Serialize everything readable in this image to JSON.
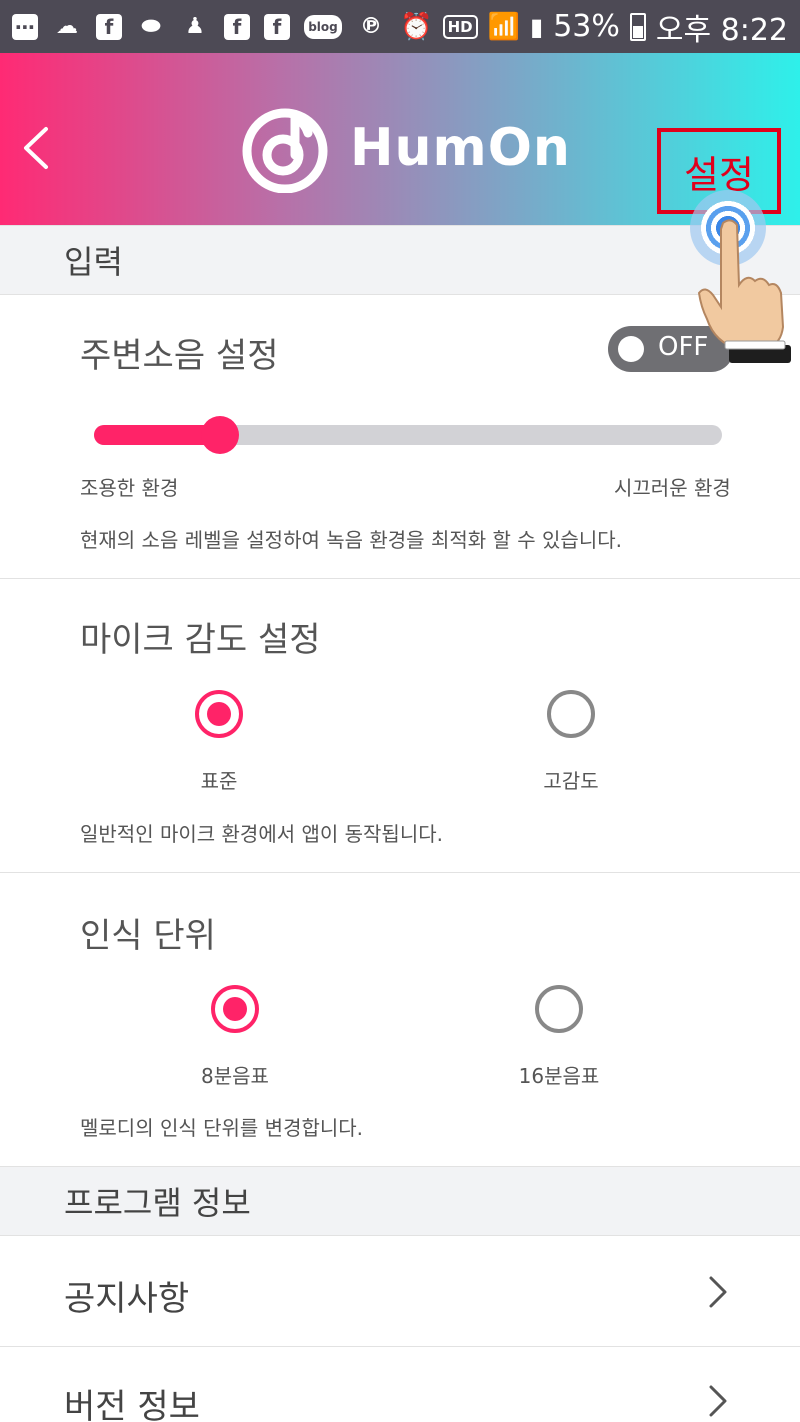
{
  "status_bar": {
    "blog_label": "blog",
    "hd_label": "HD",
    "battery": "53%",
    "time": "오후 8:22"
  },
  "header": {
    "app_name": "HumOn",
    "settings_label": "설정"
  },
  "sections": {
    "input_header": "입력",
    "program_info_header": "프로그램 정보"
  },
  "noise": {
    "title": "주변소음 설정",
    "toggle_label": "OFF",
    "slider_min_label": "조용한 환경",
    "slider_max_label": "시끄러운 환경",
    "slider_value": 0.2,
    "description": "현재의 소음 레벨을 설정하여 녹음 환경을 최적화 할 수 있습니다."
  },
  "mic": {
    "title": "마이크 감도 설정",
    "options": [
      "표준",
      "고감도"
    ],
    "selected": 0,
    "description": "일반적인 마이크 환경에서 앱이 동작됩니다."
  },
  "recognition": {
    "title": "인식 단위",
    "options": [
      "8분음표",
      "16분음표"
    ],
    "selected": 0,
    "description": "멜로디의 인식 단위를 변경합니다."
  },
  "list": {
    "notice": "공지사항",
    "version": "버전 정보"
  },
  "colors": {
    "accent": "#ff2368",
    "highlight_box": "#e0001b"
  }
}
